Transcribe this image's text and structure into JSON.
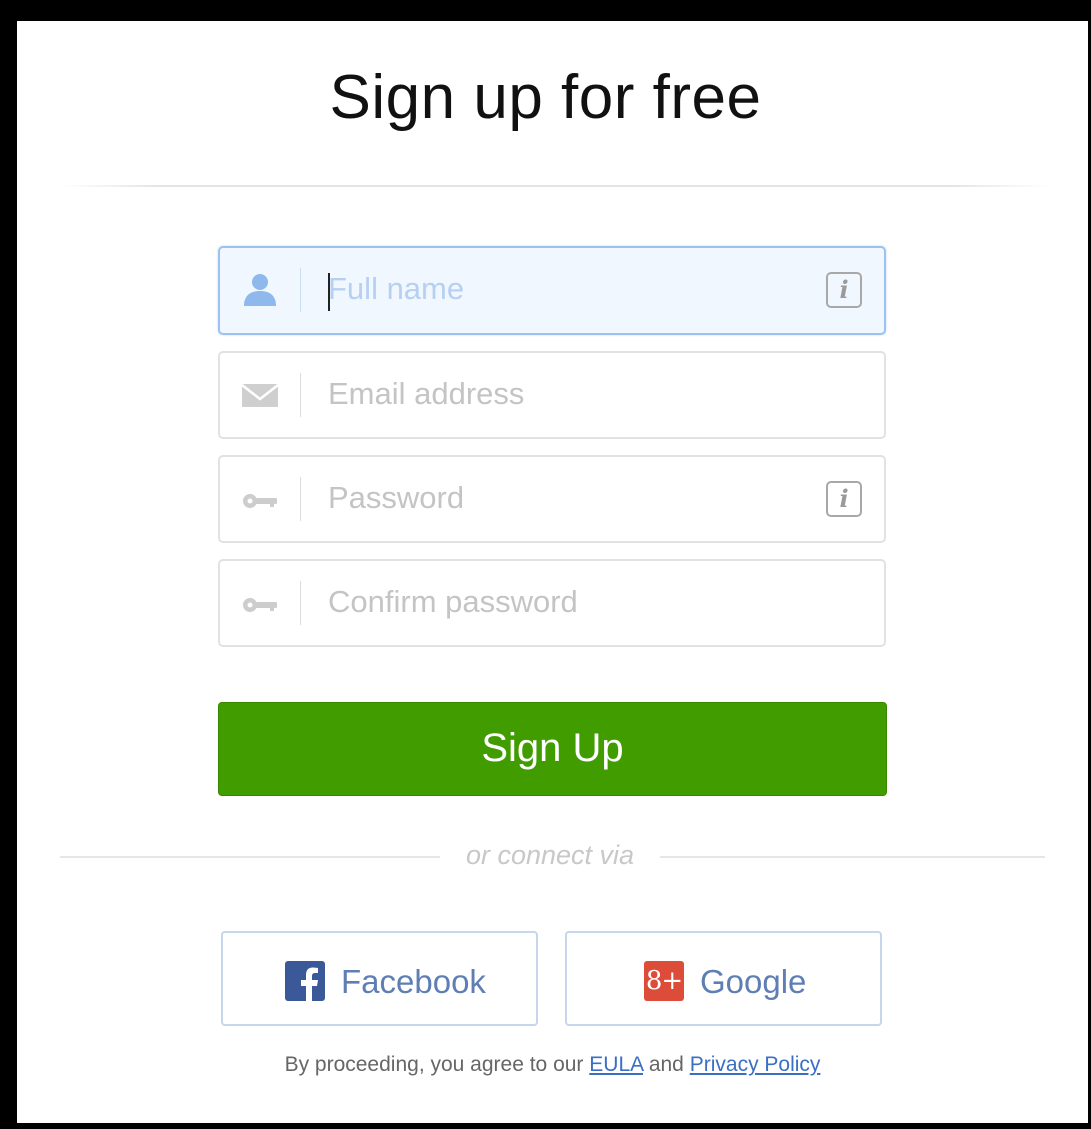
{
  "page": {
    "title": "Sign up for free"
  },
  "form": {
    "full_name": {
      "placeholder": "Full name",
      "value": "",
      "icon": "user-icon",
      "info": "i"
    },
    "email": {
      "placeholder": "Email address",
      "value": "",
      "icon": "envelope-icon"
    },
    "password": {
      "placeholder": "Password",
      "value": "",
      "icon": "key-icon",
      "info": "i"
    },
    "confirm_password": {
      "placeholder": "Confirm password",
      "value": "",
      "icon": "key-icon"
    },
    "submit_label": "Sign Up"
  },
  "divider": {
    "text": "or connect via"
  },
  "social": {
    "facebook": {
      "label": "Facebook",
      "icon": "facebook-icon",
      "glyph": "f",
      "color": "#3b5998"
    },
    "google": {
      "label": "Google",
      "icon": "google-plus-icon",
      "glyph": "8+",
      "color": "#dd4b39"
    }
  },
  "legal": {
    "prefix": "By proceeding, you agree to our",
    "eula": "EULA",
    "conjunction": "and",
    "privacy": "Privacy Policy"
  },
  "colors": {
    "primary_button": "#419c00",
    "focus_border": "#9cc2ef",
    "link": "#3a6fc4"
  }
}
